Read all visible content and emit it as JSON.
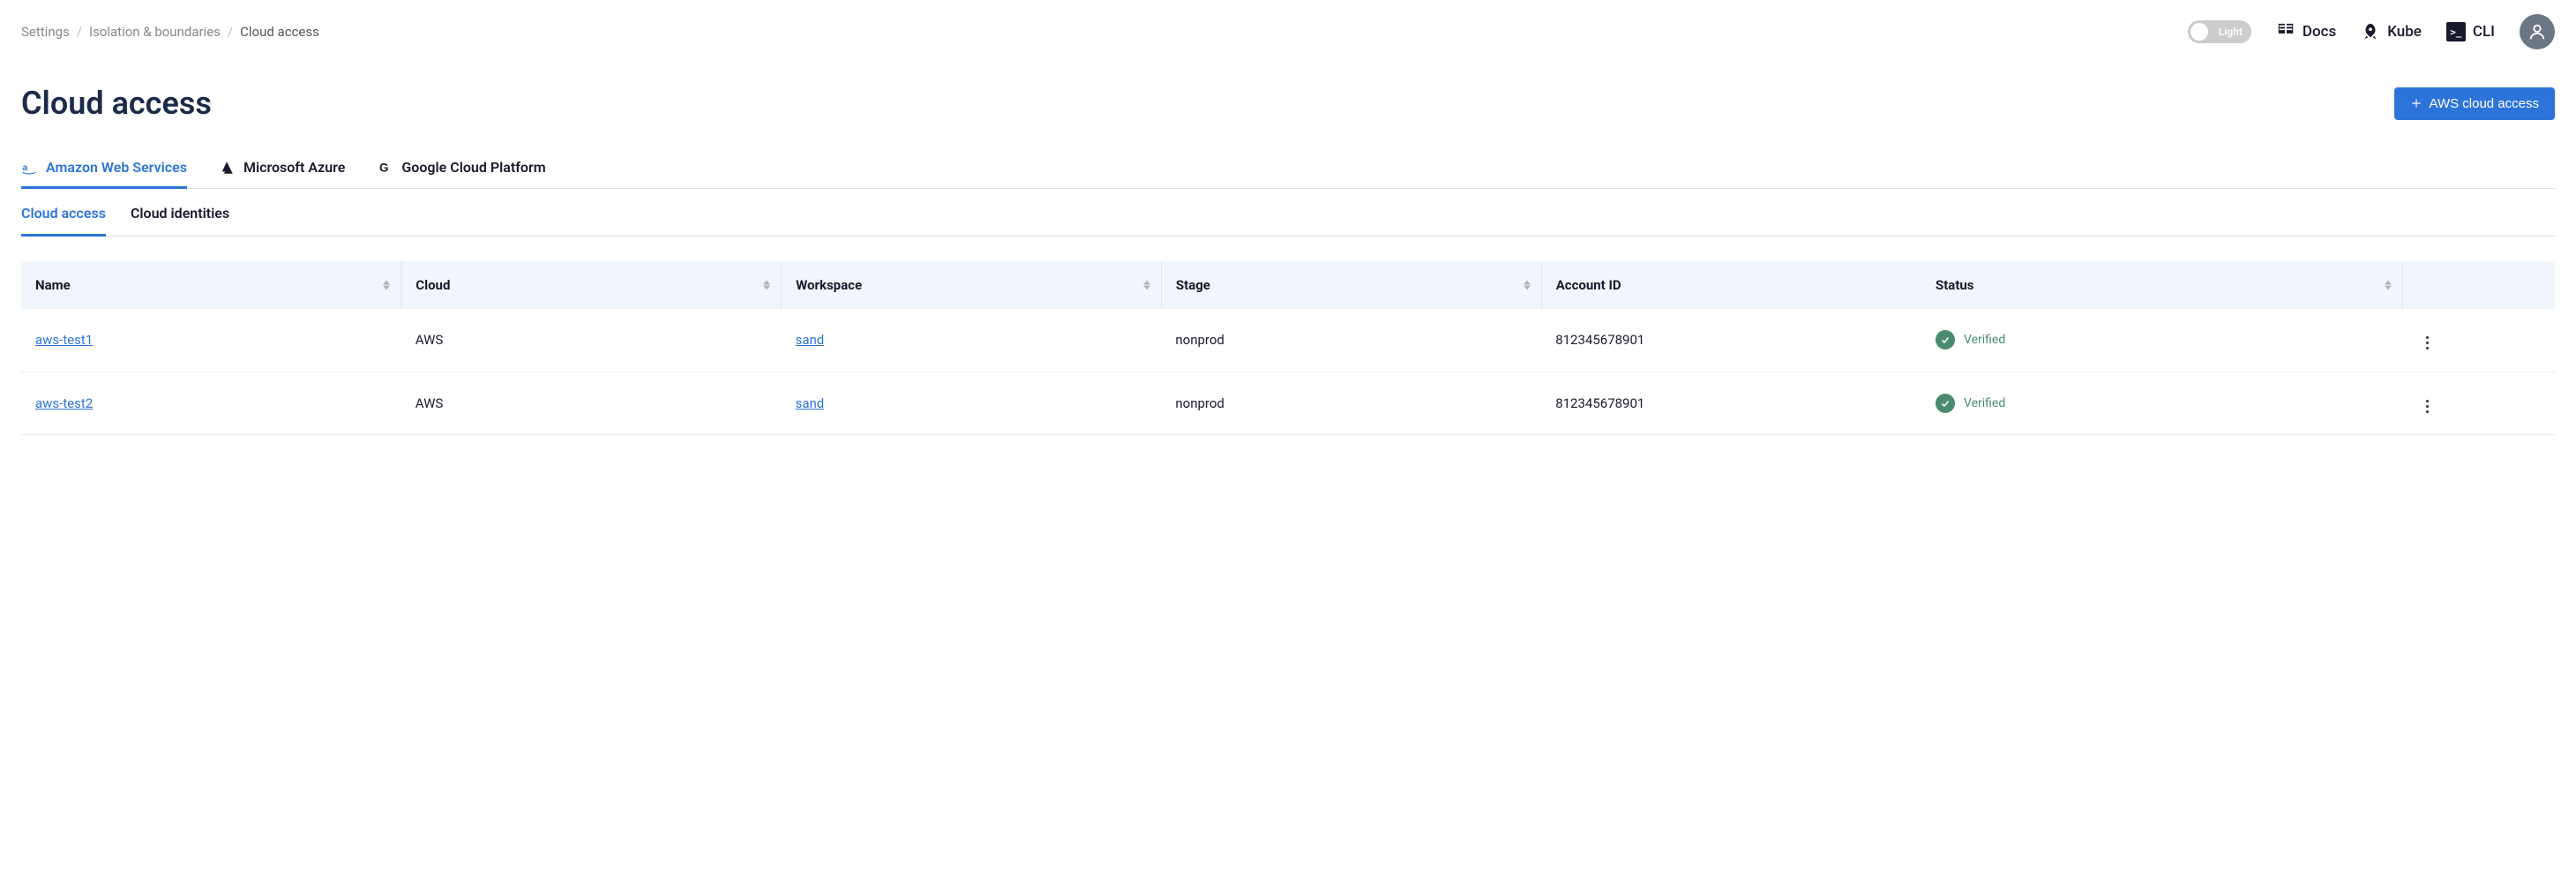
{
  "breadcrumb": {
    "items": [
      "Settings",
      "Isolation & boundaries",
      "Cloud access"
    ]
  },
  "topbar": {
    "toggle_label": "Light",
    "nav": {
      "docs": "Docs",
      "kube": "Kube",
      "cli": "CLI"
    }
  },
  "page": {
    "title": "Cloud access",
    "primary_btn": "AWS cloud access"
  },
  "provider_tabs": [
    {
      "label": "Amazon Web Services",
      "active": true
    },
    {
      "label": "Microsoft Azure",
      "active": false
    },
    {
      "label": "Google Cloud Platform",
      "active": false
    }
  ],
  "sub_tabs": [
    {
      "label": "Cloud access",
      "active": true
    },
    {
      "label": "Cloud identities",
      "active": false
    }
  ],
  "table": {
    "headers": {
      "name": "Name",
      "cloud": "Cloud",
      "workspace": "Workspace",
      "stage": "Stage",
      "account_id": "Account ID",
      "status": "Status"
    },
    "rows": [
      {
        "name": "aws-test1",
        "cloud": "AWS",
        "workspace": "sand",
        "stage": "nonprod",
        "account_id": "812345678901",
        "status": "Verified"
      },
      {
        "name": "aws-test2",
        "cloud": "AWS",
        "workspace": "sand",
        "stage": "nonprod",
        "account_id": "812345678901",
        "status": "Verified"
      }
    ]
  }
}
